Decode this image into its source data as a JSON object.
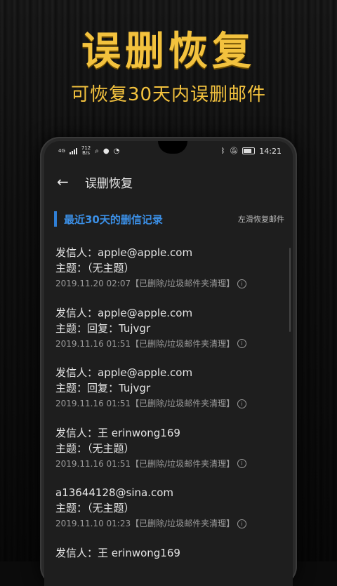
{
  "promo": {
    "headline": "误删恢复",
    "subhead": "可恢复30天内误删邮件"
  },
  "status_bar": {
    "network": "4G",
    "speed_value": "712",
    "speed_unit": "B/s",
    "time": "14:21"
  },
  "app_bar": {
    "back_icon": "arrow-left",
    "title": "误删恢复"
  },
  "section": {
    "title": "最近30天的删信记录",
    "hint": "左滑恢复邮件"
  },
  "emails": [
    {
      "sender": "发信人：apple@apple.com",
      "subject": "主题：（无主题）",
      "meta": "2019.11.20 02:07【已删除/垃圾邮件夹清理】"
    },
    {
      "sender": "发信人：apple@apple.com",
      "subject": "主题：回复：Tujvgr",
      "meta": "2019.11.16 01:51【已删除/垃圾邮件夹清理】"
    },
    {
      "sender": "发信人：apple@apple.com",
      "subject": "主题：回复：Tujvgr",
      "meta": "2019.11.16 01:51【已删除/垃圾邮件夹清理】"
    },
    {
      "sender": "发信人：王 erinwong169",
      "subject": "主题：（无主题）",
      "meta": "2019.11.16 01:51【已删除/垃圾邮件夹清理】"
    },
    {
      "sender": "a13644128@sina.com",
      "subject": "主题：（无主题）",
      "meta": "2019.11.10 01:23【已删除/垃圾邮件夹清理】"
    },
    {
      "sender": "发信人：王 erinwong169",
      "subject": "",
      "meta": ""
    }
  ],
  "info_icon_glyph": "i",
  "colors": {
    "promo_gold": "#f3c23e",
    "accent_blue": "#2f7fd6"
  }
}
